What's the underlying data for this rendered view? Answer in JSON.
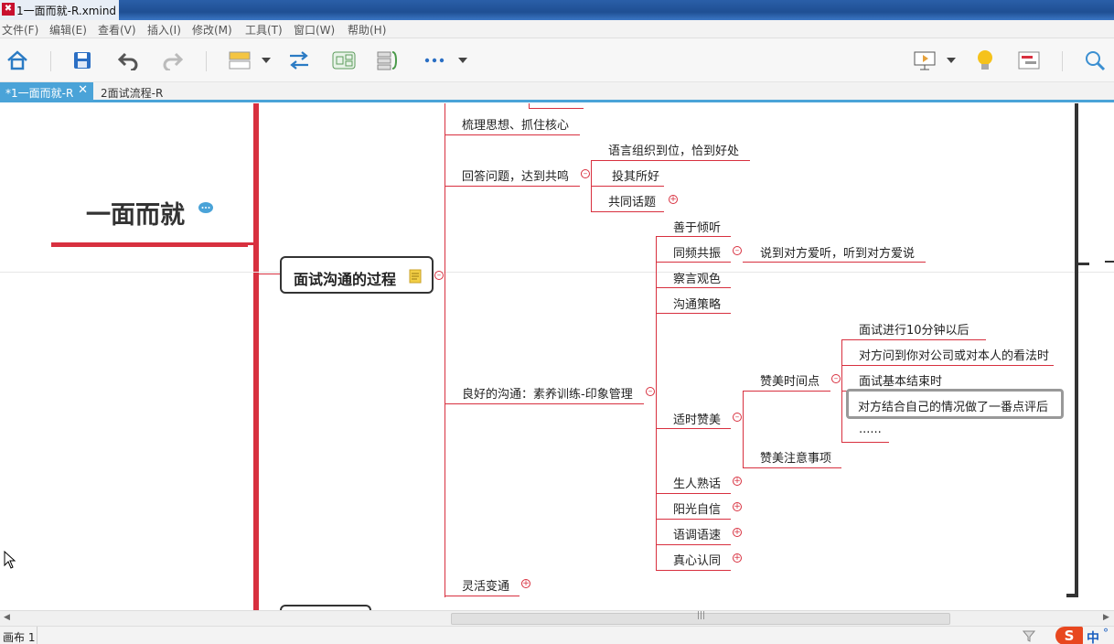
{
  "window": {
    "title": "1一面而就-R.xmind"
  },
  "menu": [
    "文件(F)",
    "编辑(E)",
    "查看(V)",
    "插入(I)",
    "修改(M)",
    "工具(T)",
    "窗口(W)",
    "帮助(H)"
  ],
  "tabs": [
    {
      "label": "*1一面而就-R",
      "active": true
    },
    {
      "label": "2面试流程-R",
      "active": false
    }
  ],
  "mindmap": {
    "root": "一面而就",
    "branch": "面试沟通的过程",
    "topics": {
      "t1": "梳理思想、抓住核心",
      "t2": "回答问题，达到共鸣",
      "t2a": "语言组织到位，恰到好处",
      "t2b": "投其所好",
      "t2c": "共同话题",
      "t3": "良好的沟通：素养训练-印象管理",
      "t3a": "善于倾听",
      "t3b": "同频共振",
      "t3b1": "说到对方爱听，听到对方爱说",
      "t3c": "察言观色",
      "t3d": "沟通策略",
      "t3e": "适时赞美",
      "t3e1": "赞美时间点",
      "t3e1a": "面试进行10分钟以后",
      "t3e1b": "对方问到你对公司或对本人的看法时",
      "t3e1c": "面试基本结束时",
      "t3e1d": "对方结合自己的情况做了一番点评后",
      "t3e1e": "......",
      "t3e2": "赞美注意事项",
      "t3f": "生人熟话",
      "t3g": "阳光自信",
      "t3h": "语调语速",
      "t3i": "真心认同",
      "t4": "灵活变通"
    }
  },
  "status": {
    "canvas_label": "画布 1",
    "ime": "中"
  },
  "colors": {
    "branch_line": "#d8303f",
    "tab_active": "#4aa3d8"
  }
}
